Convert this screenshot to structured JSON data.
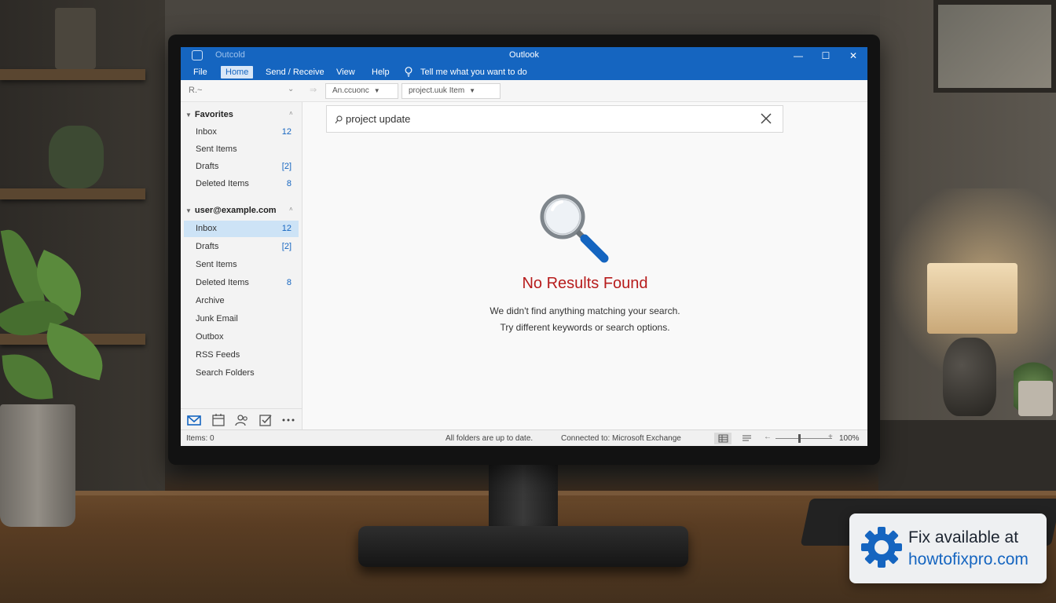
{
  "window": {
    "title": "Outlook",
    "faded_title": "Outcold"
  },
  "menu": {
    "items": [
      {
        "label": "File"
      },
      {
        "label": "Home",
        "active": true
      },
      {
        "label": "Send / Receive"
      },
      {
        "label": "View"
      },
      {
        "label": "Help"
      }
    ],
    "tell_me": "Tell me what you want to do"
  },
  "toolbar": {
    "left_search_glyph": "R.~",
    "dropdown_1": "An.ccuonc",
    "dropdown_2": "project.uuk Item"
  },
  "sidebar": {
    "favorites": {
      "label": "Favorites",
      "items": [
        {
          "label": "Inbox",
          "count": "12"
        },
        {
          "label": "Sent Items",
          "count": ""
        },
        {
          "label": "Drafts",
          "count": "[2]"
        },
        {
          "label": "Deleted Items",
          "count": "8"
        }
      ]
    },
    "account": {
      "label": "user@example.com",
      "items": [
        {
          "label": "Inbox",
          "count": "12",
          "selected": true
        },
        {
          "label": "Drafts",
          "count": "[2]"
        },
        {
          "label": "Sent Items",
          "count": ""
        },
        {
          "label": "Deleted Items",
          "count": "8"
        },
        {
          "label": "Archive",
          "count": ""
        },
        {
          "label": "Junk Email",
          "count": ""
        },
        {
          "label": "Outbox",
          "count": ""
        },
        {
          "label": "RSS Feeds",
          "count": ""
        },
        {
          "label": "Search Folders",
          "count": ""
        }
      ]
    },
    "bottom_nav": [
      "mail-icon",
      "calendar-icon",
      "people-icon",
      "tasks-icon",
      "more-icon"
    ]
  },
  "search": {
    "value": "project update"
  },
  "results": {
    "title": "No Results Found",
    "line1": "We didn't find anything matching your search.",
    "line2": "Try different keywords or search options."
  },
  "status": {
    "items": "Items: 0",
    "sync": "All folders are up to date.",
    "connection": "Connected to: Microsoft Exchange",
    "zoom": "100%"
  },
  "badge": {
    "line1": "Fix available at",
    "line2": "howtofixpro.com"
  },
  "colors": {
    "accent": "#1565c0",
    "error": "#b71c1c",
    "selected": "#cde3f6"
  }
}
